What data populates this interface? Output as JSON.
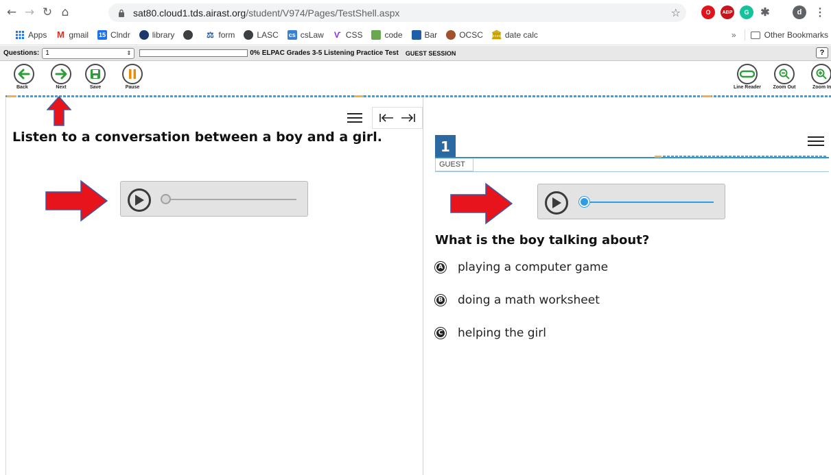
{
  "browser": {
    "url_host": "sat80.cloud1.tds.airast.org",
    "url_path": "/student/V974/Pages/TestShell.aspx",
    "profile_initial": "d"
  },
  "bookmarks": {
    "items": [
      {
        "label": "Apps",
        "icon": "apps-grid-icon"
      },
      {
        "label": "gmail",
        "icon": "gmail-icon"
      },
      {
        "label": "Clndr",
        "icon": "calendar-icon"
      },
      {
        "label": "library",
        "icon": "globe-icon"
      },
      {
        "label": "",
        "icon": "globe-icon"
      },
      {
        "label": "form",
        "icon": "scales-icon"
      },
      {
        "label": "LASC",
        "icon": "globe-icon"
      },
      {
        "label": "csLaw",
        "icon": "cs-icon"
      },
      {
        "label": "CSS",
        "icon": "css-icon"
      },
      {
        "label": "code",
        "icon": "code-icon"
      },
      {
        "label": "Bar",
        "icon": "bar-icon"
      },
      {
        "label": "OCSC",
        "icon": "ocsc-icon"
      },
      {
        "label": "date calc",
        "icon": "bank-icon"
      }
    ],
    "more": "»",
    "other": "Other Bookmarks"
  },
  "testbar": {
    "questions_label": "Questions:",
    "question_selected": "1",
    "progress_percent": 0,
    "progress_text": "0%",
    "test_title": "ELPAC Grades 3-5 Listening Practice Test",
    "session": "GUEST SESSION",
    "help": "?"
  },
  "tools": {
    "back": "Back",
    "next": "Next",
    "save": "Save",
    "pause": "Pause",
    "line_reader": "Line Reader",
    "zoom_out": "Zoom Out",
    "zoom_in": "Zoom In"
  },
  "stimulus": {
    "text": "Listen to a conversation between a boy and a girl.",
    "audio_progress": 0
  },
  "item": {
    "number": "1",
    "guest_tab": "GUEST",
    "question": "What is the boy talking about?",
    "audio_progress": 0,
    "options": [
      {
        "letter": "A",
        "text": "playing a computer game"
      },
      {
        "letter": "B",
        "text": "doing a math worksheet"
      },
      {
        "letter": "C",
        "text": "helping the girl"
      }
    ]
  },
  "colors": {
    "accent_blue": "#2a6aa0",
    "dash_blue": "#39a3d8",
    "dash_orange": "#f0b050",
    "arrow_red": "#e8141b",
    "tool_green": "#2e9e3a",
    "tool_orange": "#f08a00"
  }
}
